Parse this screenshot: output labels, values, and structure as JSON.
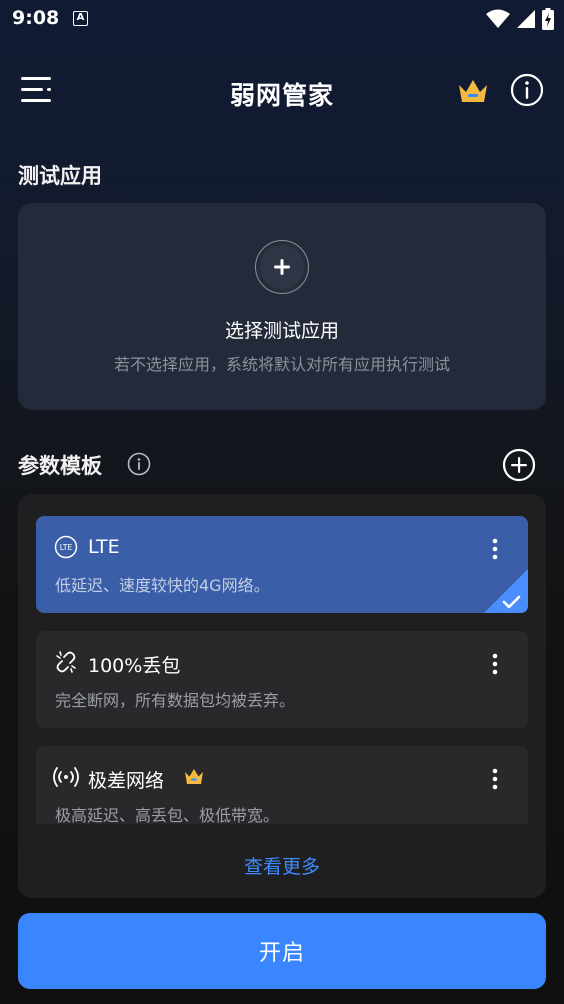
{
  "status_bar": {
    "time": "9:08",
    "notification_letter": "A"
  },
  "app_bar": {
    "title": "弱网管家"
  },
  "test_app_section": {
    "title": "测试应用",
    "select_title": "选择测试应用",
    "select_desc": "若不选择应用，系统将默认对所有应用执行测试"
  },
  "params_section": {
    "title": "参数模板",
    "items": [
      {
        "icon": "lte-icon",
        "name": "LTE",
        "desc": "低延迟、速度较快的4G网络。",
        "selected": true,
        "premium": false
      },
      {
        "icon": "broken-link-icon",
        "name": "100%丢包",
        "desc": "完全断网，所有数据包均被丢弃。",
        "selected": false,
        "premium": false
      },
      {
        "icon": "signal-broadcast-icon",
        "name": "极差网络",
        "desc": "极高延迟、高丢包、极低带宽。",
        "selected": false,
        "premium": true
      }
    ],
    "see_more": "查看更多"
  },
  "actions": {
    "start": "开启"
  },
  "colors": {
    "accent": "#3a86ff",
    "selected": "#3a5fa8",
    "crown": "#f5b940"
  }
}
